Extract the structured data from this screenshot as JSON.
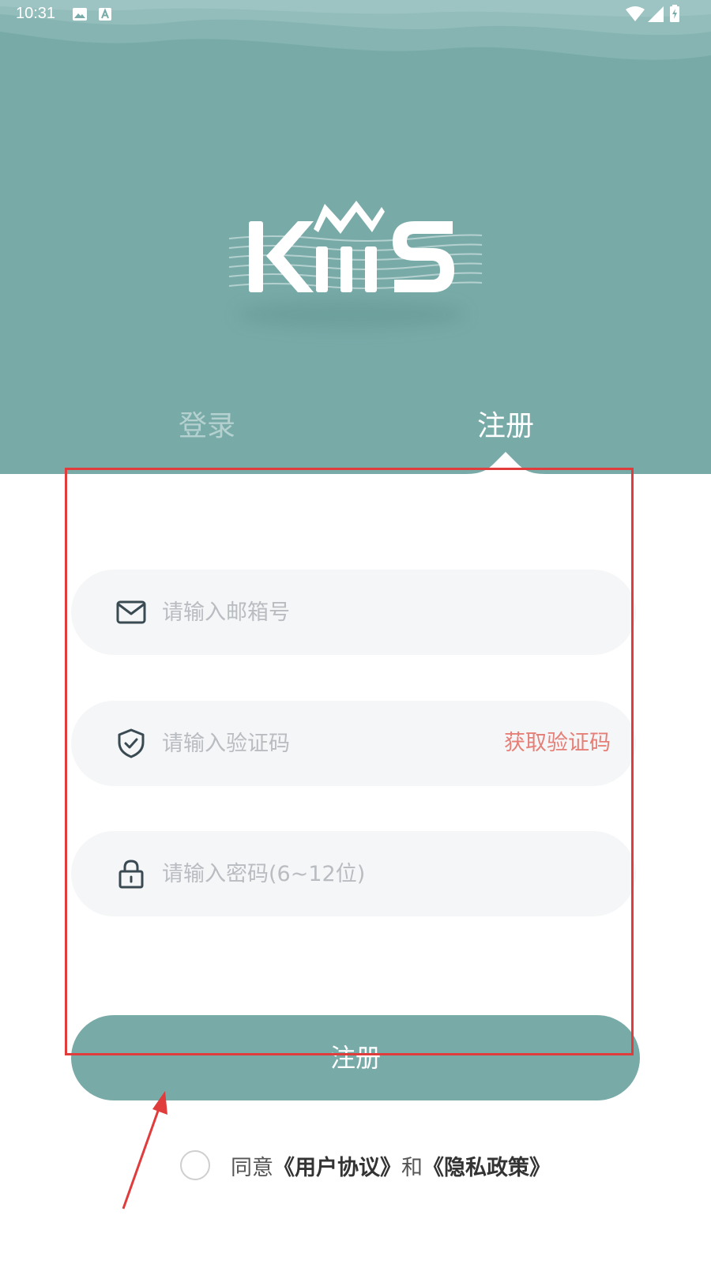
{
  "status_bar": {
    "time": "10:31",
    "icons": [
      "image-icon",
      "a-notification-icon",
      "wifi-icon",
      "signal-icon",
      "battery-icon"
    ]
  },
  "logo": {
    "text": "KMS"
  },
  "tabs": [
    {
      "label": "登录",
      "active": false
    },
    {
      "label": "注册",
      "active": true
    }
  ],
  "form": {
    "email": {
      "placeholder": "请输入邮箱号",
      "value": "",
      "icon": "mail-icon"
    },
    "code": {
      "placeholder": "请输入验证码",
      "value": "",
      "icon": "shield-check-icon",
      "action_label": "获取验证码"
    },
    "password": {
      "placeholder": "请输入密码(6~12位)",
      "value": "",
      "icon": "lock-icon"
    },
    "submit_label": "注册"
  },
  "agreement": {
    "prefix": "同意",
    "user_agreement": "《用户协议》",
    "conjunction": "和",
    "privacy_policy": "《隐私政策》",
    "checked": false
  },
  "colors": {
    "brand": "#78aba8",
    "accent": "#e67f77",
    "annotation": "#e03c3c",
    "field_bg": "#f5f6f7"
  }
}
